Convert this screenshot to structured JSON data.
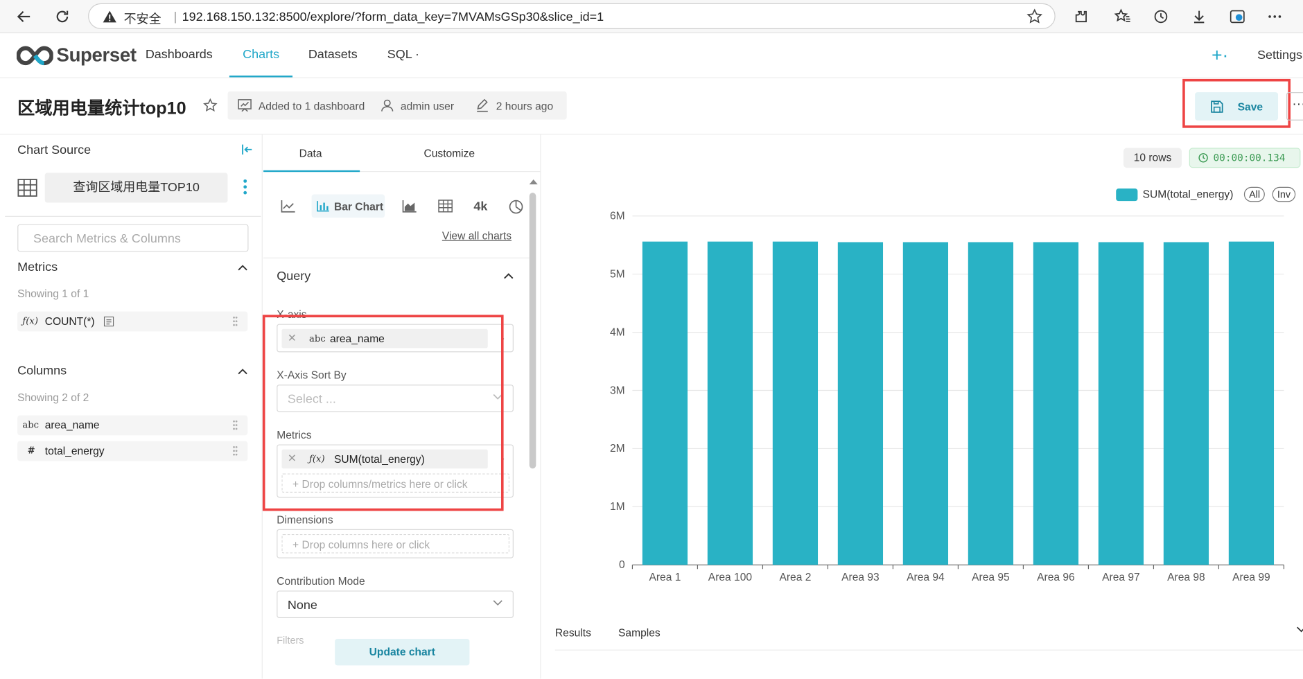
{
  "browser": {
    "insecure_label": "不安全",
    "separator": "|",
    "url": "192.168.150.132:8500/explore/?form_data_key=7MVAMsGSp30&slice_id=1"
  },
  "nav": {
    "logo_text": "Superset",
    "items": [
      {
        "label": "Dashboards",
        "active": false
      },
      {
        "label": "Charts",
        "active": true
      },
      {
        "label": "Datasets",
        "active": false
      },
      {
        "label": "SQL ·",
        "active": false
      }
    ],
    "plus": "+·",
    "settings": "Settings"
  },
  "header": {
    "title": "区域用电量统计top10",
    "added_to": "Added to 1 dashboard",
    "owner": "admin user",
    "modified": "2 hours ago",
    "save_label": "Save",
    "more": "···"
  },
  "datasource": {
    "panel_title": "Chart Source",
    "dataset_name": "查询区域用电量TOP10",
    "search_placeholder": "Search Metrics & Columns",
    "metrics_title": "Metrics",
    "metrics_showing": "Showing 1 of 1",
    "metrics": [
      {
        "type": "ƒ(x)",
        "name": "COUNT(*)"
      }
    ],
    "columns_title": "Columns",
    "columns_showing": "Showing 2 of 2",
    "columns": [
      {
        "type": "abc",
        "name": "area_name"
      },
      {
        "type": "#",
        "name": "total_energy"
      }
    ]
  },
  "controls": {
    "tab_data": "Data",
    "tab_customize": "Customize",
    "viz_active": "Bar Chart",
    "viz_4k": "4k",
    "view_all": "View all charts",
    "query_title": "Query",
    "xaxis_label": "X-axis",
    "xaxis_value": {
      "type": "abc",
      "name": "area_name"
    },
    "sortby_label": "X-Axis Sort By",
    "sortby_placeholder": "Select ...",
    "metrics_label": "Metrics",
    "metric_value": {
      "type": "ƒ(x)",
      "name": "SUM(total_energy)"
    },
    "metrics_drop": "Drop columns/metrics here or click",
    "dimensions_label": "Dimensions",
    "dimensions_drop": "Drop columns here or click",
    "contribution_label": "Contribution Mode",
    "contribution_value": "None",
    "filters_label": "Filters",
    "update_label": "Update chart"
  },
  "chart_meta": {
    "rows": "10 rows",
    "timer": "00:00:00.134",
    "legend_all": "All",
    "legend_inv": "Inv"
  },
  "results": {
    "tab_results": "Results",
    "tab_samples": "Samples"
  },
  "colors": {
    "accent": "#20a7c9",
    "bar": "#29b2c5",
    "highlight": "#ee4444"
  },
  "chart_data": {
    "type": "bar",
    "categories": [
      "Area 1",
      "Area 100",
      "Area 2",
      "Area 93",
      "Area 94",
      "Area 95",
      "Area 96",
      "Area 97",
      "Area 98",
      "Area 99"
    ],
    "series": [
      {
        "name": "SUM(total_energy)",
        "values": [
          5560000,
          5560000,
          5560000,
          5550000,
          5550000,
          5550000,
          5550000,
          5550000,
          5550000,
          5560000
        ]
      }
    ],
    "yticks": [
      "0",
      "1M",
      "2M",
      "3M",
      "4M",
      "5M",
      "6M"
    ],
    "ylim": [
      0,
      6000000
    ],
    "grid": true,
    "legend": "top-right"
  }
}
